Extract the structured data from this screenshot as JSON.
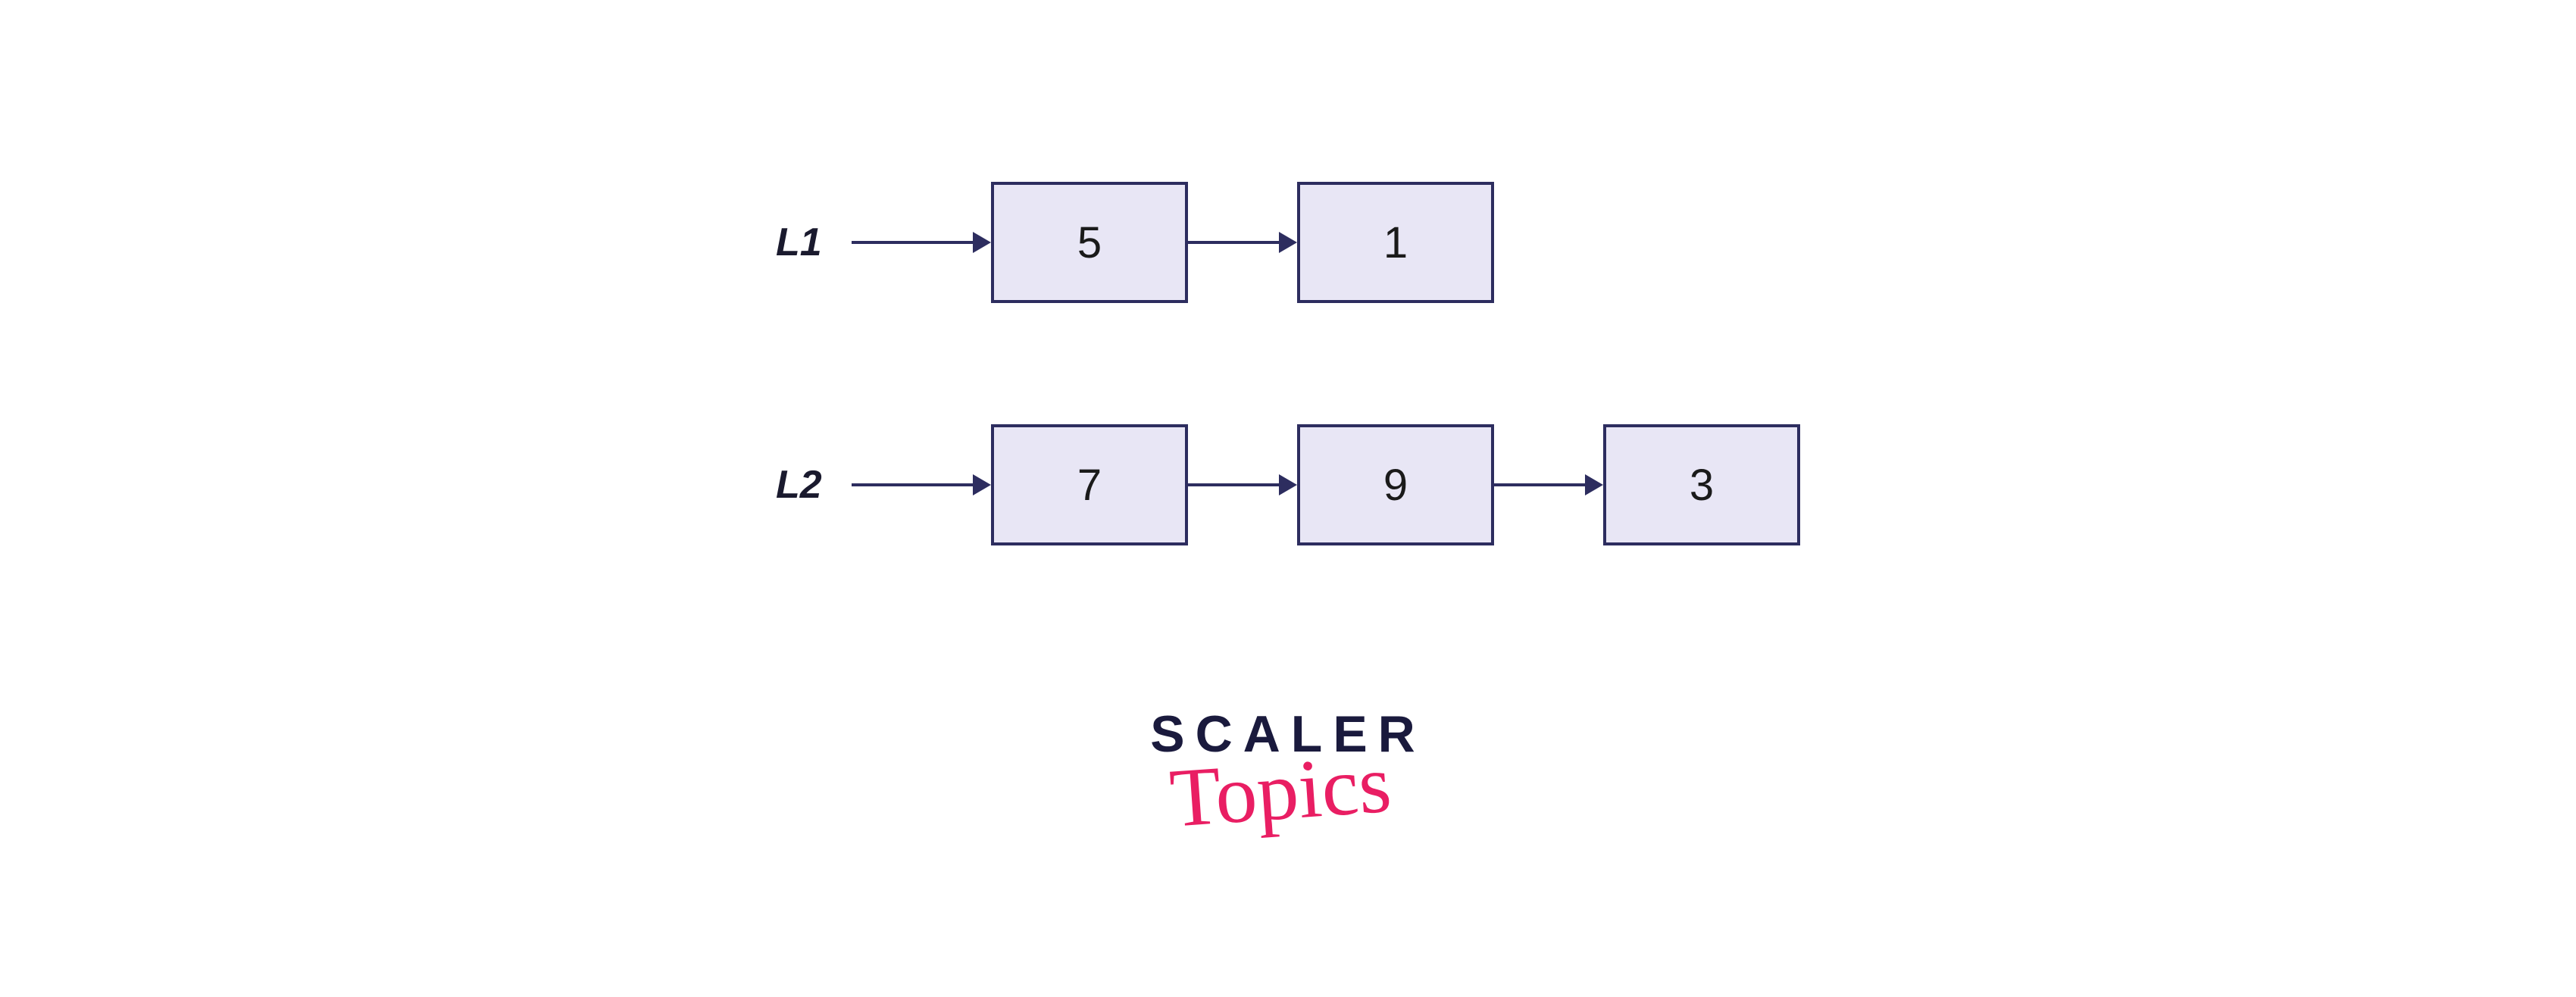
{
  "lists": [
    {
      "label": "L1",
      "nodes": [
        "5",
        "1"
      ]
    },
    {
      "label": "L2",
      "nodes": [
        "7",
        "9",
        "3"
      ]
    }
  ],
  "logo": {
    "line1": "SCALER",
    "line2": "Topics"
  }
}
